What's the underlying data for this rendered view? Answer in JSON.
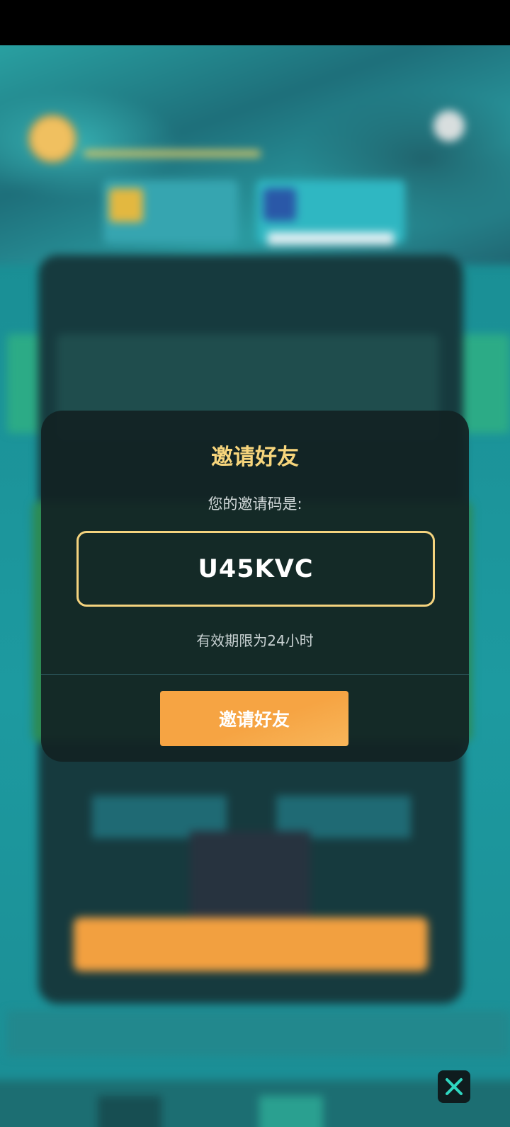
{
  "modal": {
    "title": "邀请好友",
    "subtitle": "您的邀请码是:",
    "invite_code": "U45KVC",
    "validity": "有效期限为24小时",
    "button_label": "邀请好友"
  },
  "colors": {
    "title": "#f7d57c",
    "code_border": "#f4d37e",
    "button": "#f6a443",
    "close_icon": "#2fd6c0"
  },
  "icons": {
    "close": "close-icon"
  }
}
